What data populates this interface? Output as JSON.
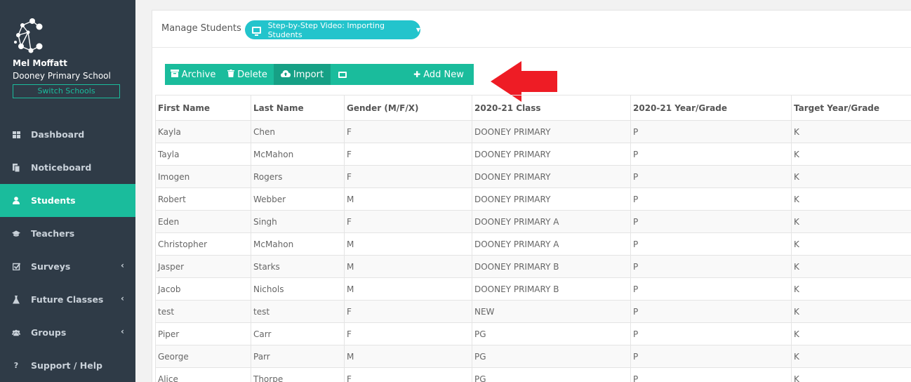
{
  "sidebar": {
    "user_name": "Mel Moffatt",
    "school_name": "Dooney Primary School",
    "switch_label": "Switch Schools",
    "items": [
      {
        "label": "Dashboard",
        "icon": "dashboard-icon",
        "active": false,
        "caret": false
      },
      {
        "label": "Noticeboard",
        "icon": "noticeboard-icon",
        "active": false,
        "caret": false
      },
      {
        "label": "Students",
        "icon": "user-icon",
        "active": true,
        "caret": false
      },
      {
        "label": "Teachers",
        "icon": "graduation-cap-icon",
        "active": false,
        "caret": false
      },
      {
        "label": "Surveys",
        "icon": "check-square-icon",
        "active": false,
        "caret": true
      },
      {
        "label": "Future Classes",
        "icon": "flask-icon",
        "active": false,
        "caret": true
      },
      {
        "label": "Groups",
        "icon": "users-icon",
        "active": false,
        "caret": true
      },
      {
        "label": "Support / Help",
        "icon": "question-icon",
        "active": false,
        "caret": false
      }
    ]
  },
  "header": {
    "title": "Manage Students",
    "video_label": "Step-by-Step Video: Importing Students"
  },
  "toolbar": {
    "archive_label": "Archive",
    "delete_label": "Delete",
    "import_label": "Import",
    "add_new_label": "Add New"
  },
  "table": {
    "columns": [
      "First Name",
      "Last Name",
      "Gender (M/F/X)",
      "2020-21 Class",
      "2020-21 Year/Grade",
      "Target Year/Grade"
    ],
    "rows": [
      [
        "Kayla",
        "Chen",
        "F",
        "DOONEY PRIMARY",
        "P",
        "K"
      ],
      [
        "Tayla",
        "McMahon",
        "F",
        "DOONEY PRIMARY",
        "P",
        "K"
      ],
      [
        "Imogen",
        "Rogers",
        "F",
        "DOONEY PRIMARY",
        "P",
        "K"
      ],
      [
        "Robert",
        "Webber",
        "M",
        "DOONEY PRIMARY",
        "P",
        "K"
      ],
      [
        "Eden",
        "Singh",
        "F",
        "DOONEY PRIMARY A",
        "P",
        "K"
      ],
      [
        "Christopher",
        "McMahon",
        "M",
        "DOONEY PRIMARY A",
        "P",
        "K"
      ],
      [
        "Jasper",
        "Starks",
        "M",
        "DOONEY PRIMARY B",
        "P",
        "K"
      ],
      [
        "Jacob",
        "Nichols",
        "M",
        "DOONEY PRIMARY B",
        "P",
        "K"
      ],
      [
        "test",
        "test",
        "F",
        "NEW",
        "P",
        "K"
      ],
      [
        "Piper",
        "Carr",
        "F",
        "PG",
        "P",
        "K"
      ],
      [
        "George",
        "Parr",
        "M",
        "PG",
        "P",
        "K"
      ],
      [
        "Alice",
        "Thorpe",
        "F",
        "PG",
        "P",
        "K"
      ]
    ]
  },
  "colors": {
    "sidebar_bg": "#2f3b47",
    "accent": "#1abc9c",
    "accent_dark": "#16a085",
    "video_btn": "#23c4cc",
    "arrow": "#ee1c25"
  }
}
